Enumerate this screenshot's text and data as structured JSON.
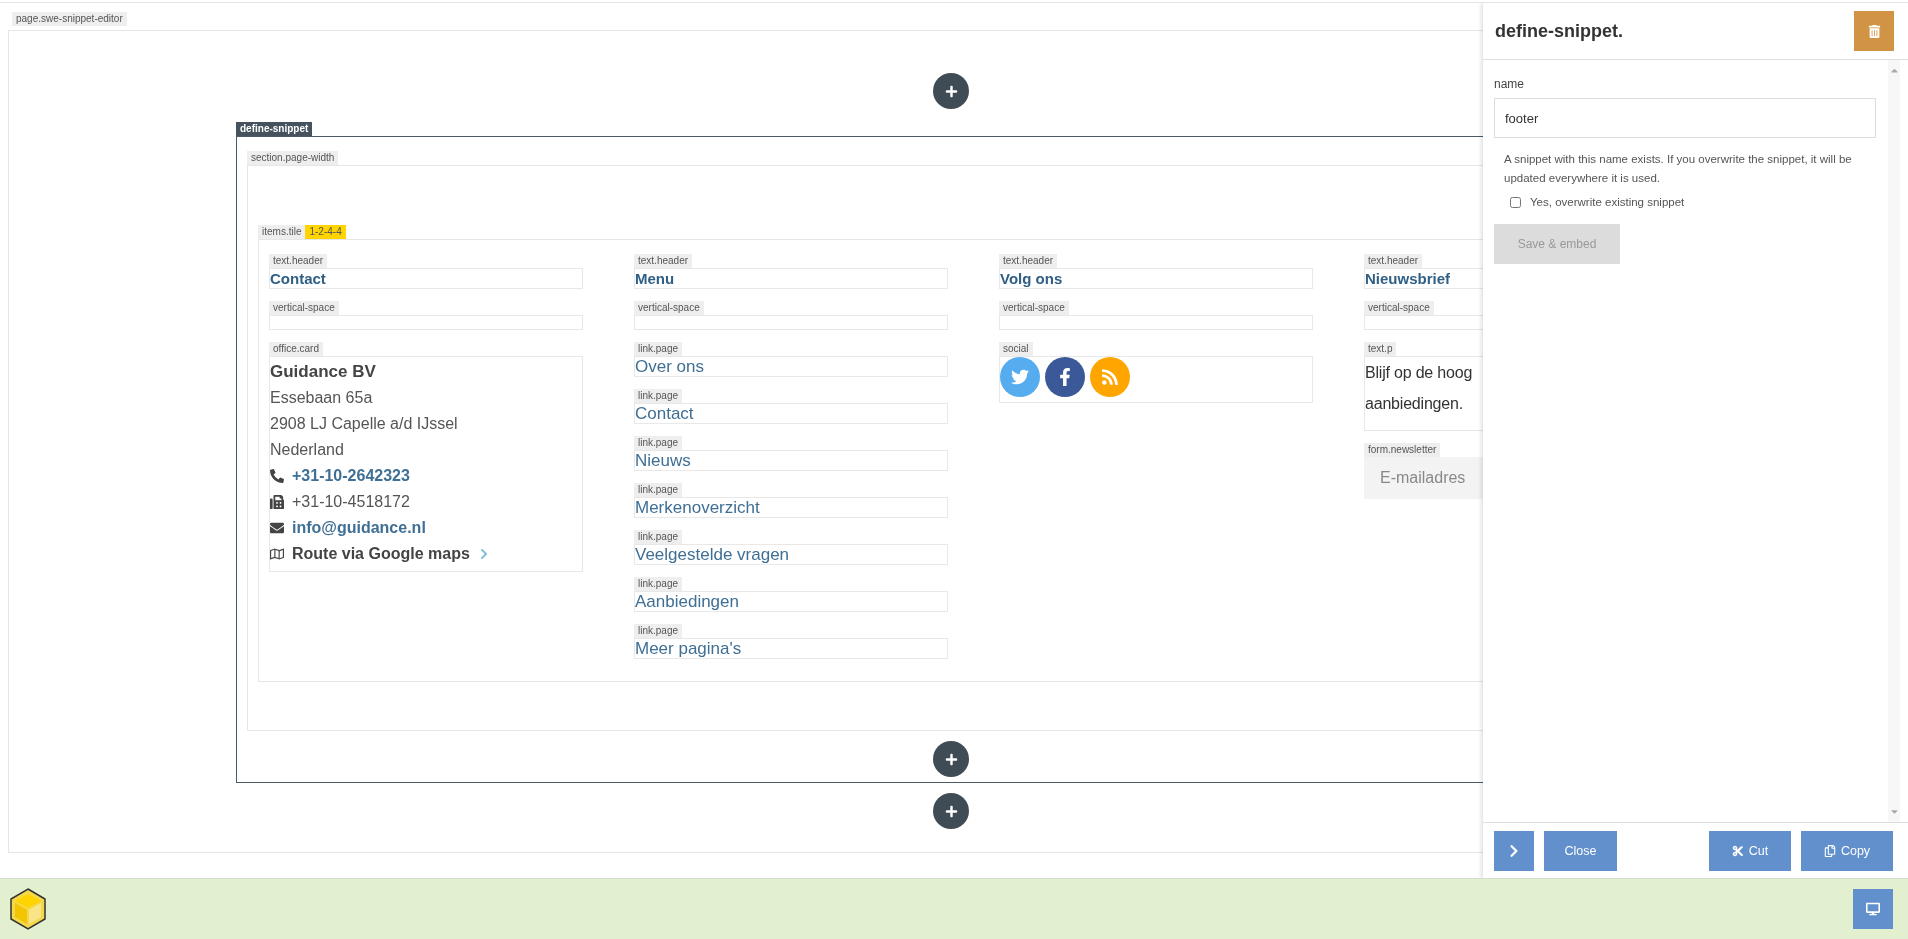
{
  "editor": {
    "label": "page.swe-snippet-editor",
    "snippet": {
      "label": "define-snippet",
      "section": {
        "label": "section.page-width",
        "tile": {
          "label": "items.tile",
          "badge": "1-2-4-4",
          "columns": [
            {
              "blocks": [
                {
                  "kind": "header",
                  "label": "text.header",
                  "text": "Contact"
                },
                {
                  "kind": "space",
                  "label": "vertical-space"
                },
                {
                  "kind": "office",
                  "label": "office.card",
                  "name": "Guidance BV",
                  "lines": [
                    "Essebaan 65a",
                    "2908 LJ Capelle a/d IJssel",
                    "Nederland"
                  ],
                  "contacts": [
                    {
                      "kind": "phone",
                      "text": "+31-10-2642323"
                    },
                    {
                      "kind": "fax",
                      "text": "+31-10-4518172"
                    },
                    {
                      "kind": "email",
                      "text": "info@guidance.nl"
                    },
                    {
                      "kind": "route",
                      "text": "Route via Google maps"
                    }
                  ]
                }
              ]
            },
            {
              "blocks": [
                {
                  "kind": "header",
                  "label": "text.header",
                  "text": "Menu"
                },
                {
                  "kind": "space",
                  "label": "vertical-space"
                },
                {
                  "kind": "link",
                  "label": "link.page",
                  "text": "Over ons"
                },
                {
                  "kind": "link",
                  "label": "link.page",
                  "text": "Contact"
                },
                {
                  "kind": "link",
                  "label": "link.page",
                  "text": "Nieuws"
                },
                {
                  "kind": "link",
                  "label": "link.page",
                  "text": "Merkenoverzicht"
                },
                {
                  "kind": "link",
                  "label": "link.page",
                  "text": "Veelgestelde vragen"
                },
                {
                  "kind": "link",
                  "label": "link.page",
                  "text": "Aanbiedingen"
                },
                {
                  "kind": "link",
                  "label": "link.page",
                  "text": "Meer pagina's"
                }
              ]
            },
            {
              "blocks": [
                {
                  "kind": "header",
                  "label": "text.header",
                  "text": "Volg ons"
                },
                {
                  "kind": "space",
                  "label": "vertical-space"
                },
                {
                  "kind": "social",
                  "label": "social",
                  "items": [
                    {
                      "kind": "twitter"
                    },
                    {
                      "kind": "facebook"
                    },
                    {
                      "kind": "rss"
                    }
                  ]
                }
              ]
            },
            {
              "blocks": [
                {
                  "kind": "header",
                  "label": "text.header",
                  "text": "Nieuwsbrief"
                },
                {
                  "kind": "space",
                  "label": "vertical-space"
                },
                {
                  "kind": "paragraph",
                  "label": "text.p",
                  "lines": [
                    "Blijf op de hoog",
                    "aanbiedingen."
                  ]
                },
                {
                  "kind": "newsletter",
                  "label": "form.newsletter",
                  "placeholder": "E-mailadres"
                }
              ]
            }
          ]
        }
      }
    }
  },
  "panel": {
    "title": "define-snippet.",
    "field": {
      "label": "name",
      "value": "footer"
    },
    "notice": "A snippet with this name exists. If you overwrite the snippet, it will be updated everywhere it is used.",
    "checkbox": {
      "label": "Yes, overwrite existing snippet",
      "checked": false
    },
    "save": {
      "label": "Save & embed",
      "disabled": true
    },
    "footer_buttons": [
      {
        "kind": "expand"
      },
      {
        "kind": "close",
        "label": "Close"
      },
      {
        "kind": "cut",
        "label": "Cut"
      },
      {
        "kind": "copy",
        "label": "Copy"
      }
    ]
  }
}
